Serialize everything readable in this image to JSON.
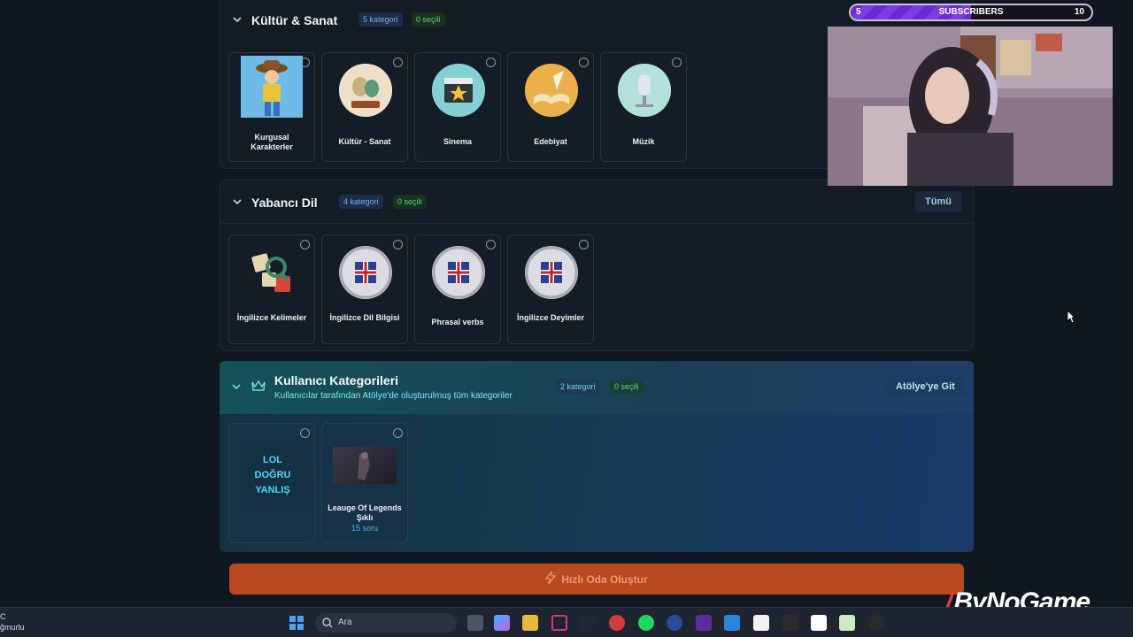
{
  "sections": {
    "kultur": {
      "title": "Kültür & Sanat",
      "count_badge": "5 kategori",
      "selected_badge": "0 seçili",
      "cards": [
        {
          "label": "Kurgusal Karakterler"
        },
        {
          "label": "Kültür - Sanat"
        },
        {
          "label": "Sinema"
        },
        {
          "label": "Edebiyat"
        },
        {
          "label": "Müzik"
        }
      ]
    },
    "yabanci": {
      "title": "Yabancı Dil",
      "count_badge": "4 kategori",
      "selected_badge": "0 seçili",
      "all_button": "Tümü",
      "cards": [
        {
          "label": "İngilizce Kelimeler"
        },
        {
          "label": "İngilizce Dil Bilgisi"
        },
        {
          "label": "Phrasal verbs"
        },
        {
          "label": "İngilizce Deyimler"
        }
      ]
    },
    "kullanici": {
      "title": "Kullanıcı Kategorileri",
      "subtitle": "Kullanıcılar tarafından Atölye'de oluşturulmuş tüm kategoriler",
      "count_badge": "2 kategori",
      "selected_badge": "0 seçili",
      "workshop_button": "Atölye'ye Git",
      "cards": [
        {
          "logo_text": "LOL DOĞRU YANLIŞ"
        },
        {
          "label": "Leauge Of Legends Şıklı",
          "sub": "15 soru"
        }
      ]
    }
  },
  "cta": {
    "label": "Hızlı Oda Oluştur"
  },
  "subscribers": {
    "current": "5",
    "label": "SUBSCRIBERS",
    "goal": "10",
    "progress": 0.5
  },
  "watermark": "ByNoGame",
  "taskbar": {
    "left_text_1": "C",
    "left_text_2": "ğmurlu",
    "search_placeholder": "Ara"
  }
}
